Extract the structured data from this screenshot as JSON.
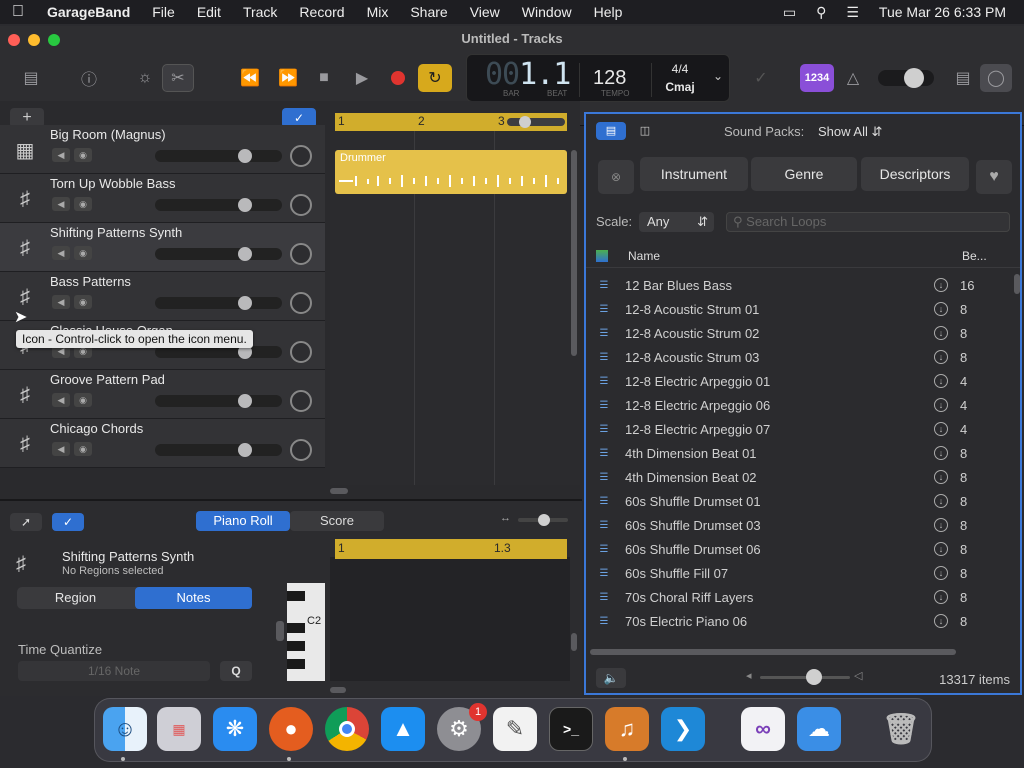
{
  "menubar": {
    "app": "GarageBand",
    "items": [
      "File",
      "Edit",
      "Track",
      "Record",
      "Mix",
      "Share",
      "View",
      "Window",
      "Help"
    ],
    "datetime": "Tue Mar 26  6:33 PM"
  },
  "window": {
    "title": "Untitled - Tracks"
  },
  "lcd": {
    "bar_dim": "00",
    "bar": "1",
    "beat": "1",
    "bar_label": "BAR",
    "beat_label": "BEAT",
    "tempo": "128",
    "tempo_label": "TEMPO",
    "time_signature": "4/4",
    "key": "Cmaj"
  },
  "toolbar": {
    "count_in": "1234"
  },
  "ruler": {
    "marks": [
      "1",
      "2",
      "3"
    ]
  },
  "region": {
    "name": "Drummer"
  },
  "tracks": [
    {
      "name": "Big Room (Magnus)",
      "icon": "drum-machine-icon"
    },
    {
      "name": "Torn Up Wobble Bass",
      "icon": "keyboard-icon"
    },
    {
      "name": "Shifting Patterns Synth",
      "icon": "keyboard-icon"
    },
    {
      "name": "Bass Patterns",
      "icon": "keyboard-icon"
    },
    {
      "name": "Classic House Organ",
      "icon": "keyboard-icon"
    },
    {
      "name": "Groove Pattern Pad",
      "icon": "keyboard-icon"
    },
    {
      "name": "Chicago Chords",
      "icon": "keyboard-icon"
    }
  ],
  "tooltip": "Icon - Control-click to open the icon menu.",
  "editor": {
    "tab_piano_roll": "Piano Roll",
    "tab_score": "Score",
    "track_name": "Shifting Patterns Synth",
    "selection": "No Regions selected",
    "tab_region": "Region",
    "tab_notes": "Notes",
    "time_quantize_label": "Time Quantize",
    "time_quantize_value": "1/16 Note",
    "q_button": "Q",
    "ruler_marks": [
      "1",
      "1.3"
    ],
    "note_label": "C2"
  },
  "loops": {
    "sound_packs_label": "Sound Packs:",
    "sound_packs_value": "Show All",
    "filter_instrument": "Instrument",
    "filter_genre": "Genre",
    "filter_descriptors": "Descriptors",
    "scale_label": "Scale:",
    "scale_value": "Any",
    "search_placeholder": "Search Loops",
    "col_name": "Name",
    "col_beats": "Be...",
    "items_count": "13317 items",
    "rows": [
      {
        "name": "12 Bar Blues Bass",
        "beats": "16"
      },
      {
        "name": "12-8 Acoustic Strum 01",
        "beats": "8"
      },
      {
        "name": "12-8 Acoustic Strum 02",
        "beats": "8"
      },
      {
        "name": "12-8 Acoustic Strum 03",
        "beats": "8"
      },
      {
        "name": "12-8 Electric Arpeggio 01",
        "beats": "4"
      },
      {
        "name": "12-8 Electric Arpeggio 06",
        "beats": "4"
      },
      {
        "name": "12-8 Electric Arpeggio 07",
        "beats": "4"
      },
      {
        "name": "4th Dimension Beat 01",
        "beats": "8"
      },
      {
        "name": "4th Dimension Beat 02",
        "beats": "8"
      },
      {
        "name": "60s Shuffle Drumset 01",
        "beats": "8"
      },
      {
        "name": "60s Shuffle Drumset 03",
        "beats": "8"
      },
      {
        "name": "60s Shuffle Drumset 06",
        "beats": "8"
      },
      {
        "name": "60s Shuffle Fill 07",
        "beats": "8"
      },
      {
        "name": "70s Choral Riff Layers",
        "beats": "8"
      },
      {
        "name": "70s Electric Piano 06",
        "beats": "8"
      }
    ]
  },
  "dock": {
    "apps": [
      "Finder",
      "Launchpad",
      "Safari",
      "Firefox",
      "Chrome",
      "App Store",
      "System Settings",
      "TextEdit",
      "Terminal",
      "GarageBand",
      "VS Code",
      "Visual Studio",
      "Weather",
      "Trash"
    ],
    "badge_system_settings": "1"
  },
  "colors": {
    "accent": "#2f6fd0",
    "region_yellow": "#e5c14a",
    "record_red": "#e0342f",
    "cycle_yellow": "#d7a91c"
  }
}
